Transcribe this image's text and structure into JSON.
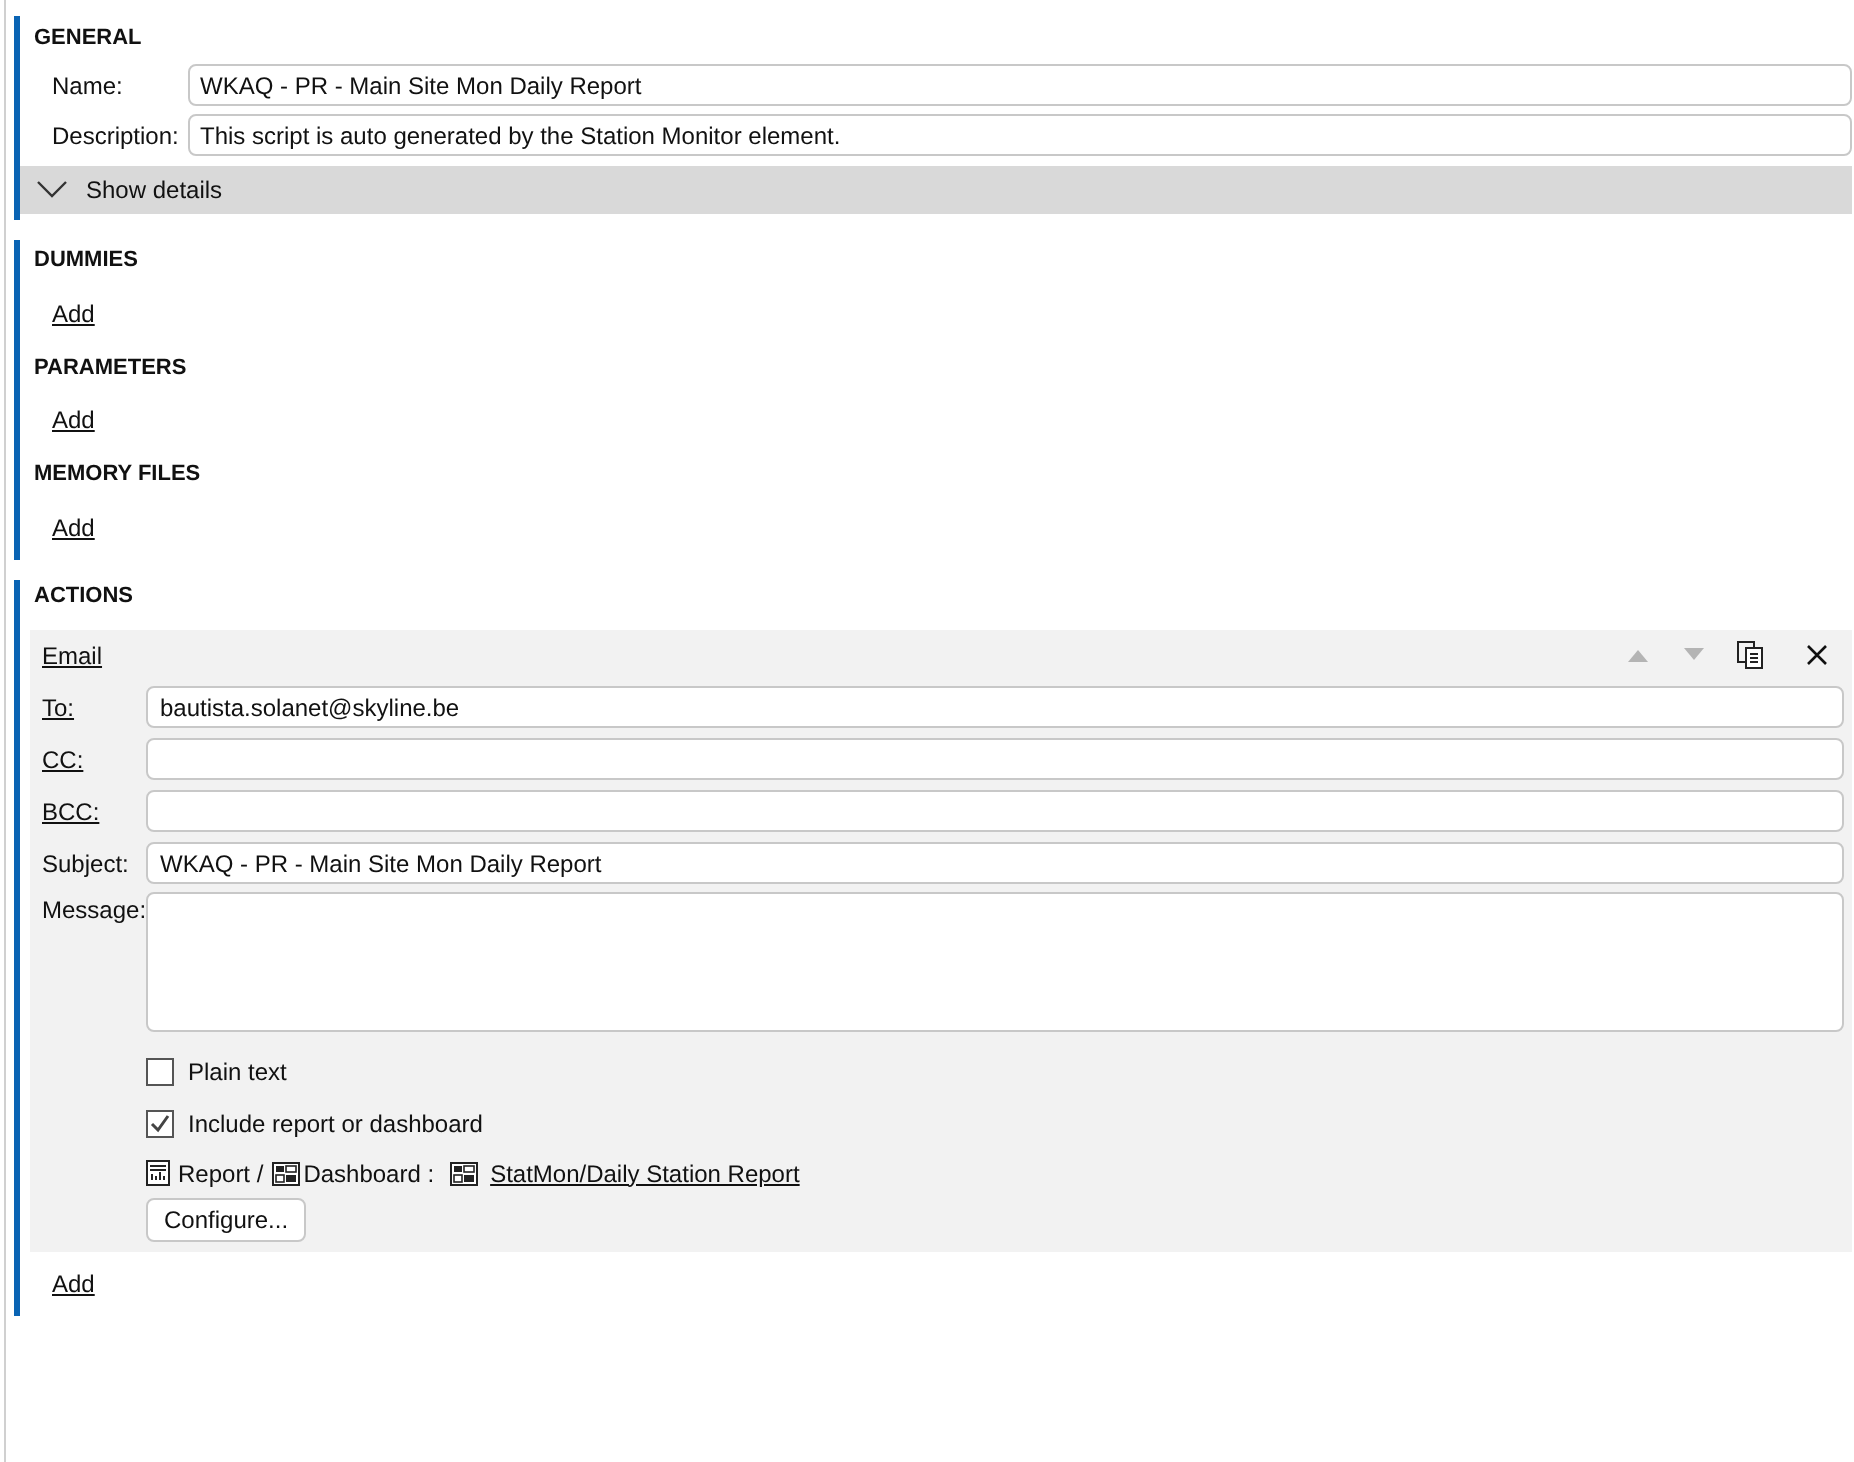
{
  "general": {
    "title": "GENERAL",
    "fields": [
      {
        "label": "Name:",
        "value": "WKAQ - PR - Main Site Mon Daily Report"
      },
      {
        "label": "Description:",
        "value": "This script is auto generated by the Station Monitor element."
      }
    ],
    "details_toggle": {
      "label": "Show details",
      "expanded": false
    }
  },
  "sections": [
    {
      "title": "DUMMIES",
      "add_link": "Add"
    },
    {
      "title": "PARAMETERS",
      "add_link": "Add"
    },
    {
      "title": "MEMORY FILES",
      "add_link": "Add"
    }
  ],
  "actions": {
    "title": "ACTIONS",
    "items": [
      {
        "kind": "email",
        "title": "Email",
        "fields": [
          {
            "label": "To:",
            "link": true,
            "value": "bautista.solanet@skyline.be"
          },
          {
            "label": "CC:",
            "link": true
          },
          {
            "label": "BCC:",
            "link": true
          },
          {
            "label": "Subject:",
            "link": false,
            "value": "WKAQ - PR - Main Site Mon Daily Report"
          }
        ],
        "message_label": "Message:",
        "options": [
          {
            "label": "Plain text",
            "checked": false
          },
          {
            "label": "Include report or dashboard",
            "checked": true
          }
        ],
        "report_label": "Report /",
        "dashboard_label": "Dashboard :",
        "report_link": "StatMon/Daily Station Report",
        "configure_button": "Configure..."
      }
    ],
    "add_link": "Add"
  }
}
